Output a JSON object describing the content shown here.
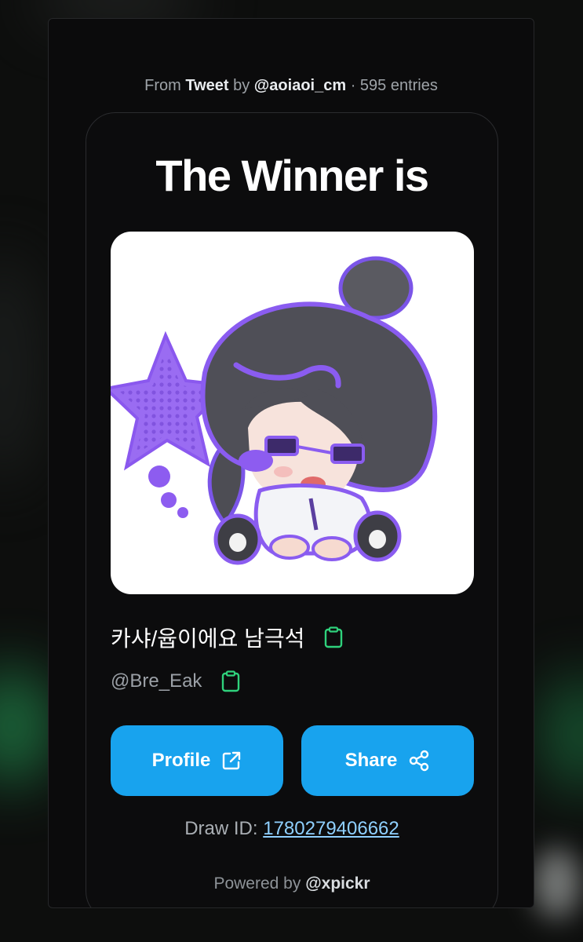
{
  "header": {
    "from_prefix": "From",
    "source": "Tweet",
    "by": "by",
    "author": "@aoiaoi_cm",
    "separator": "·",
    "entries": "595 entries"
  },
  "card": {
    "title": "The Winner is",
    "avatar_alt": "winner avatar",
    "display_name": "카샤/윱이에요 남극석",
    "handle": "@Bre_Eak"
  },
  "actions": {
    "profile_label": "Profile",
    "share_label": "Share"
  },
  "draw": {
    "label": "Draw ID:",
    "id": "1780279406662"
  },
  "footer": {
    "powered_prefix": "Powered by",
    "brand": "@xpickr"
  },
  "colors": {
    "accent_button": "#18a3ee",
    "copy_icon": "#2fd27c",
    "link": "#8fd0ff"
  },
  "icons": [
    "clipboard-icon",
    "external-link-icon",
    "share-icon"
  ]
}
